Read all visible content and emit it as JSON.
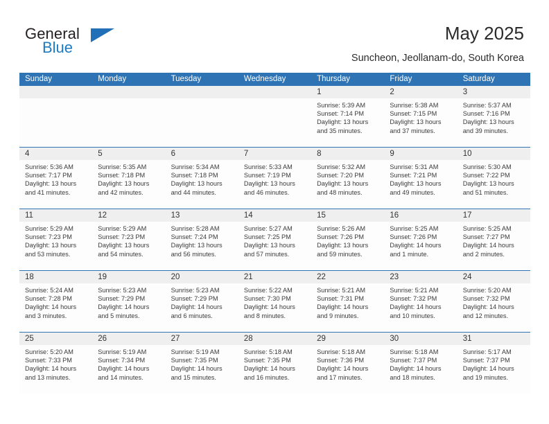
{
  "brand": {
    "word1": "General",
    "word2": "Blue",
    "logo_icon": "triangle-flag-icon"
  },
  "header": {
    "title": "May 2025",
    "subtitle": "Suncheon, Jeollanam-do, South Korea"
  },
  "colors": {
    "header_blue": "#2e74b5",
    "daynum_gray": "#efefef",
    "brand_blue": "#1f7bc1"
  },
  "calendar": {
    "weekdays": [
      "Sunday",
      "Monday",
      "Tuesday",
      "Wednesday",
      "Thursday",
      "Friday",
      "Saturday"
    ],
    "weeks": [
      [
        {
          "day": "",
          "lines": []
        },
        {
          "day": "",
          "lines": []
        },
        {
          "day": "",
          "lines": []
        },
        {
          "day": "",
          "lines": []
        },
        {
          "day": "1",
          "lines": [
            "Sunrise: 5:39 AM",
            "Sunset: 7:14 PM",
            "Daylight: 13 hours",
            "and 35 minutes."
          ]
        },
        {
          "day": "2",
          "lines": [
            "Sunrise: 5:38 AM",
            "Sunset: 7:15 PM",
            "Daylight: 13 hours",
            "and 37 minutes."
          ]
        },
        {
          "day": "3",
          "lines": [
            "Sunrise: 5:37 AM",
            "Sunset: 7:16 PM",
            "Daylight: 13 hours",
            "and 39 minutes."
          ]
        }
      ],
      [
        {
          "day": "4",
          "lines": [
            "Sunrise: 5:36 AM",
            "Sunset: 7:17 PM",
            "Daylight: 13 hours",
            "and 41 minutes."
          ]
        },
        {
          "day": "5",
          "lines": [
            "Sunrise: 5:35 AM",
            "Sunset: 7:18 PM",
            "Daylight: 13 hours",
            "and 42 minutes."
          ]
        },
        {
          "day": "6",
          "lines": [
            "Sunrise: 5:34 AM",
            "Sunset: 7:18 PM",
            "Daylight: 13 hours",
            "and 44 minutes."
          ]
        },
        {
          "day": "7",
          "lines": [
            "Sunrise: 5:33 AM",
            "Sunset: 7:19 PM",
            "Daylight: 13 hours",
            "and 46 minutes."
          ]
        },
        {
          "day": "8",
          "lines": [
            "Sunrise: 5:32 AM",
            "Sunset: 7:20 PM",
            "Daylight: 13 hours",
            "and 48 minutes."
          ]
        },
        {
          "day": "9",
          "lines": [
            "Sunrise: 5:31 AM",
            "Sunset: 7:21 PM",
            "Daylight: 13 hours",
            "and 49 minutes."
          ]
        },
        {
          "day": "10",
          "lines": [
            "Sunrise: 5:30 AM",
            "Sunset: 7:22 PM",
            "Daylight: 13 hours",
            "and 51 minutes."
          ]
        }
      ],
      [
        {
          "day": "11",
          "lines": [
            "Sunrise: 5:29 AM",
            "Sunset: 7:23 PM",
            "Daylight: 13 hours",
            "and 53 minutes."
          ]
        },
        {
          "day": "12",
          "lines": [
            "Sunrise: 5:29 AM",
            "Sunset: 7:23 PM",
            "Daylight: 13 hours",
            "and 54 minutes."
          ]
        },
        {
          "day": "13",
          "lines": [
            "Sunrise: 5:28 AM",
            "Sunset: 7:24 PM",
            "Daylight: 13 hours",
            "and 56 minutes."
          ]
        },
        {
          "day": "14",
          "lines": [
            "Sunrise: 5:27 AM",
            "Sunset: 7:25 PM",
            "Daylight: 13 hours",
            "and 57 minutes."
          ]
        },
        {
          "day": "15",
          "lines": [
            "Sunrise: 5:26 AM",
            "Sunset: 7:26 PM",
            "Daylight: 13 hours",
            "and 59 minutes."
          ]
        },
        {
          "day": "16",
          "lines": [
            "Sunrise: 5:25 AM",
            "Sunset: 7:26 PM",
            "Daylight: 14 hours",
            "and 1 minute."
          ]
        },
        {
          "day": "17",
          "lines": [
            "Sunrise: 5:25 AM",
            "Sunset: 7:27 PM",
            "Daylight: 14 hours",
            "and 2 minutes."
          ]
        }
      ],
      [
        {
          "day": "18",
          "lines": [
            "Sunrise: 5:24 AM",
            "Sunset: 7:28 PM",
            "Daylight: 14 hours",
            "and 3 minutes."
          ]
        },
        {
          "day": "19",
          "lines": [
            "Sunrise: 5:23 AM",
            "Sunset: 7:29 PM",
            "Daylight: 14 hours",
            "and 5 minutes."
          ]
        },
        {
          "day": "20",
          "lines": [
            "Sunrise: 5:23 AM",
            "Sunset: 7:29 PM",
            "Daylight: 14 hours",
            "and 6 minutes."
          ]
        },
        {
          "day": "21",
          "lines": [
            "Sunrise: 5:22 AM",
            "Sunset: 7:30 PM",
            "Daylight: 14 hours",
            "and 8 minutes."
          ]
        },
        {
          "day": "22",
          "lines": [
            "Sunrise: 5:21 AM",
            "Sunset: 7:31 PM",
            "Daylight: 14 hours",
            "and 9 minutes."
          ]
        },
        {
          "day": "23",
          "lines": [
            "Sunrise: 5:21 AM",
            "Sunset: 7:32 PM",
            "Daylight: 14 hours",
            "and 10 minutes."
          ]
        },
        {
          "day": "24",
          "lines": [
            "Sunrise: 5:20 AM",
            "Sunset: 7:32 PM",
            "Daylight: 14 hours",
            "and 12 minutes."
          ]
        }
      ],
      [
        {
          "day": "25",
          "lines": [
            "Sunrise: 5:20 AM",
            "Sunset: 7:33 PM",
            "Daylight: 14 hours",
            "and 13 minutes."
          ]
        },
        {
          "day": "26",
          "lines": [
            "Sunrise: 5:19 AM",
            "Sunset: 7:34 PM",
            "Daylight: 14 hours",
            "and 14 minutes."
          ]
        },
        {
          "day": "27",
          "lines": [
            "Sunrise: 5:19 AM",
            "Sunset: 7:35 PM",
            "Daylight: 14 hours",
            "and 15 minutes."
          ]
        },
        {
          "day": "28",
          "lines": [
            "Sunrise: 5:18 AM",
            "Sunset: 7:35 PM",
            "Daylight: 14 hours",
            "and 16 minutes."
          ]
        },
        {
          "day": "29",
          "lines": [
            "Sunrise: 5:18 AM",
            "Sunset: 7:36 PM",
            "Daylight: 14 hours",
            "and 17 minutes."
          ]
        },
        {
          "day": "30",
          "lines": [
            "Sunrise: 5:18 AM",
            "Sunset: 7:37 PM",
            "Daylight: 14 hours",
            "and 18 minutes."
          ]
        },
        {
          "day": "31",
          "lines": [
            "Sunrise: 5:17 AM",
            "Sunset: 7:37 PM",
            "Daylight: 14 hours",
            "and 19 minutes."
          ]
        }
      ]
    ]
  }
}
